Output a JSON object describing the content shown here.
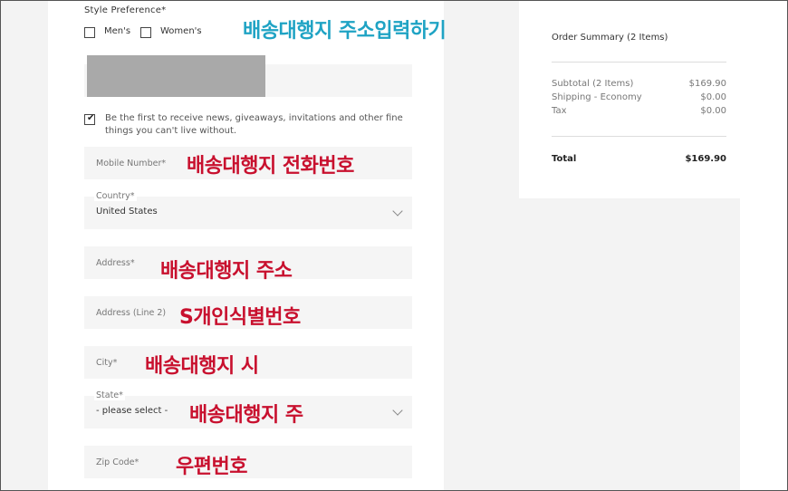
{
  "form": {
    "style_preference_label": "Style Preference*",
    "options": [
      "Men's",
      "Women's"
    ],
    "newsletter_text": "Be the first to receive news, giveaways, invitations and other fine things you can't live without.",
    "fields": {
      "mobile": {
        "label": "Mobile Number*"
      },
      "country": {
        "label": "Country*",
        "value": "United States"
      },
      "address": {
        "label": "Address*"
      },
      "address2": {
        "label": "Address (Line 2)"
      },
      "city": {
        "label": "City*"
      },
      "state": {
        "label": "State*",
        "value": "- please select -"
      },
      "zip": {
        "label": "Zip Code*"
      }
    }
  },
  "annotations": {
    "title": "배송대행지 주소입력하기",
    "mobile": "배송대행지 전화번호",
    "address": "배송대행지 주소",
    "address2": "S개인식별번호",
    "city": "배송대행지 시",
    "state": "배송대행지 주",
    "zip": "우편번호"
  },
  "summary": {
    "title": "Order Summary (2 Items)",
    "rows": [
      {
        "label": "Subtotal (2 Items)",
        "value": "$169.90"
      },
      {
        "label": "Shipping - Economy",
        "value": "$0.00"
      },
      {
        "label": "Tax",
        "value": "$0.00"
      }
    ],
    "total_label": "Total",
    "total_value": "$169.90"
  },
  "colors": {
    "annotation_red": "#c8102e",
    "annotation_cyan": "#1fa3c4"
  }
}
